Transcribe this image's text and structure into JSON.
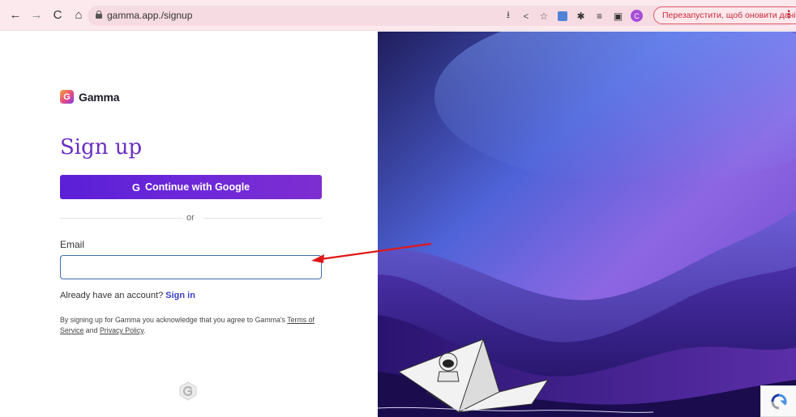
{
  "browser": {
    "url": "gamma.app./signup",
    "relaunch_label": "Перезапустити, щоб оновити дані",
    "profile_initial": "C"
  },
  "brand": {
    "name": "Gamma",
    "primary_color": "#6a2ec2",
    "button_color": "#5b1fd6",
    "link_color": "#3b3fc8"
  },
  "signup": {
    "title": "Sign up",
    "google_button": "Continue with Google",
    "divider": "or",
    "email_label": "Email",
    "email_value": "",
    "have_account": "Already have an account?",
    "sign_in": "Sign in",
    "terms_prefix": "By signing up for Gamma you acknowledge that you agree to Gamma's",
    "terms_link": "Terms of Service",
    "terms_and": "and",
    "privacy_link": "Privacy Policy",
    "terms_end": "."
  },
  "icons": {
    "back": "arrow-left-icon",
    "forward": "arrow-right-icon",
    "reload": "reload-icon",
    "home": "home-icon",
    "lock": "lock-icon",
    "install": "install-app-icon",
    "share": "share-icon",
    "bookmark": "star-icon",
    "extension_translate": "translate-extension-icon",
    "extensions": "puzzle-icon",
    "reading_list": "reading-list-icon",
    "side_panel": "side-panel-icon",
    "menu": "kebab-menu-icon"
  }
}
